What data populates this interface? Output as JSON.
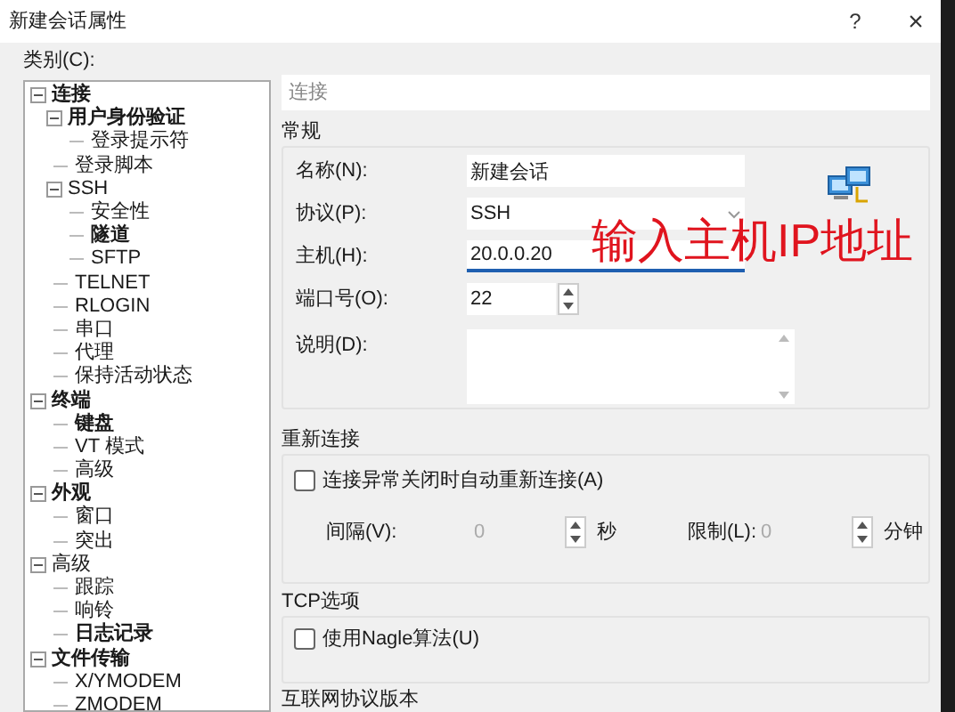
{
  "window": {
    "title": "新建会话属性",
    "help": "?",
    "close": "×"
  },
  "category_label": "类别(C):",
  "tree": [
    {
      "label": "连接",
      "bold": true,
      "expanded": true,
      "children": [
        {
          "label": "用户身份验证",
          "bold": true,
          "expanded": true,
          "children": [
            {
              "label": "登录提示符",
              "bold": false
            }
          ]
        },
        {
          "label": "登录脚本",
          "bold": false
        },
        {
          "label": "SSH",
          "bold": false,
          "expanded": true,
          "children": [
            {
              "label": "安全性",
              "bold": false
            },
            {
              "label": "隧道",
              "bold": true
            },
            {
              "label": "SFTP",
              "bold": false
            }
          ]
        },
        {
          "label": "TELNET",
          "bold": false
        },
        {
          "label": "RLOGIN",
          "bold": false
        },
        {
          "label": "串口",
          "bold": false
        },
        {
          "label": "代理",
          "bold": false
        },
        {
          "label": "保持活动状态",
          "bold": false
        }
      ]
    },
    {
      "label": "终端",
      "bold": true,
      "expanded": true,
      "children": [
        {
          "label": "键盘",
          "bold": true
        },
        {
          "label": "VT 模式",
          "bold": false
        },
        {
          "label": "高级",
          "bold": false
        }
      ]
    },
    {
      "label": "外观",
      "bold": true,
      "expanded": true,
      "children": [
        {
          "label": "窗口",
          "bold": false
        },
        {
          "label": "突出",
          "bold": false
        }
      ]
    },
    {
      "label": "高级",
      "bold": false,
      "expanded": true,
      "children": [
        {
          "label": "跟踪",
          "bold": false
        },
        {
          "label": "响铃",
          "bold": false
        },
        {
          "label": "日志记录",
          "bold": true
        }
      ]
    },
    {
      "label": "文件传输",
      "bold": true,
      "expanded": true,
      "children": [
        {
          "label": "X/YMODEM",
          "bold": false
        },
        {
          "label": "ZMODEM",
          "bold": false
        }
      ]
    }
  ],
  "section_header": "连接",
  "general": {
    "title": "常规",
    "fields": [
      {
        "kind": "text",
        "label": "名称(N):",
        "value": "新建会话"
      },
      {
        "kind": "select",
        "label": "协议(P):",
        "value": "SSH"
      },
      {
        "kind": "text",
        "label": "主机(H):",
        "value": "20.0.0.20",
        "focused": true
      },
      {
        "kind": "spin",
        "label": "端口号(O):",
        "value": "22"
      },
      {
        "kind": "textarea",
        "label": "说明(D):"
      }
    ]
  },
  "annotation": "输入主机IP地址",
  "reconnect": {
    "title": "重新连接",
    "checkbox": {
      "label": "连接异常关闭时自动重新连接(A)",
      "checked": false
    },
    "interval": {
      "label": "间隔(V):",
      "value": "0",
      "unit": "秒",
      "disabled": true
    },
    "limit": {
      "label": "限制(L):",
      "value": "0",
      "unit": "分钟",
      "disabled": true
    }
  },
  "tcp": {
    "title": "TCP选项",
    "checkbox": {
      "label": "使用Nagle算法(U)",
      "checked": false
    }
  },
  "next_section_title": "互联网协议版本"
}
